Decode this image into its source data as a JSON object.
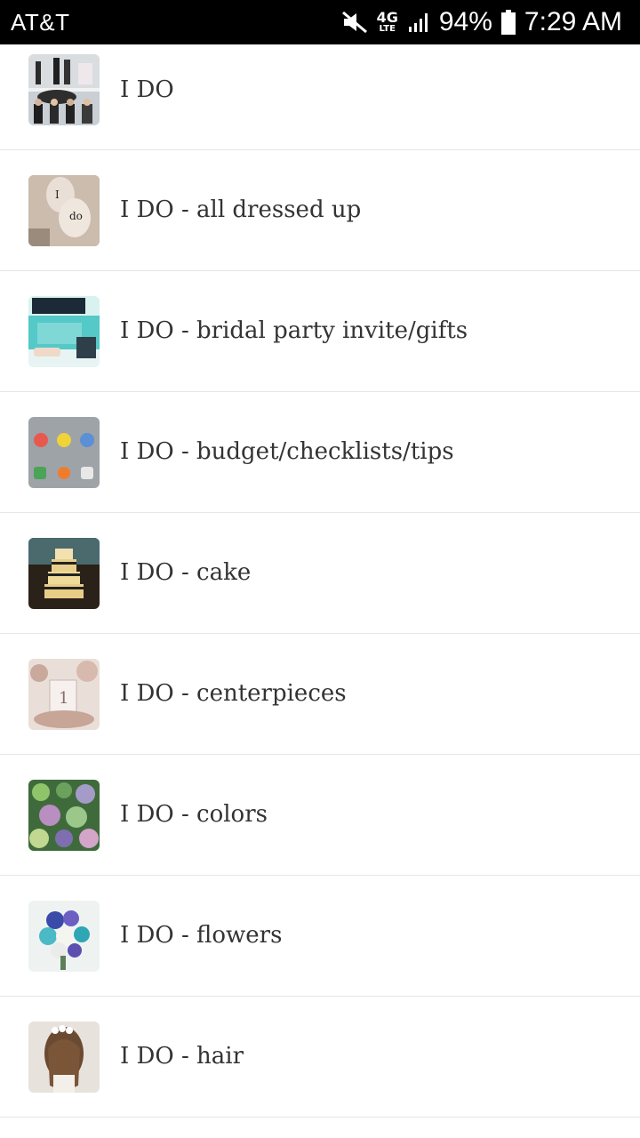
{
  "status_bar": {
    "carrier": "AT&T",
    "network": "4G",
    "network_sub": "LTE",
    "battery": "94%",
    "time": "7:29 AM",
    "icons": [
      "mute-icon",
      "signal-icon",
      "battery-icon"
    ]
  },
  "boards": [
    {
      "label": "I DO",
      "thumb": "wedding-party-photo"
    },
    {
      "label": "I DO - all dressed up",
      "thumb": "shoes-photo"
    },
    {
      "label": "I DO - bridal party invite/gifts",
      "thumb": "gift-box-photo"
    },
    {
      "label": "I DO - budget/checklists/tips",
      "thumb": "app-icons-photo"
    },
    {
      "label": "I DO - cake",
      "thumb": "cake-photo"
    },
    {
      "label": "I DO - centerpieces",
      "thumb": "centerpiece-photo"
    },
    {
      "label": "I DO - colors",
      "thumb": "succulents-photo"
    },
    {
      "label": "I DO - flowers",
      "thumb": "bouquet-photo"
    },
    {
      "label": "I DO - hair",
      "thumb": "hair-photo"
    }
  ]
}
